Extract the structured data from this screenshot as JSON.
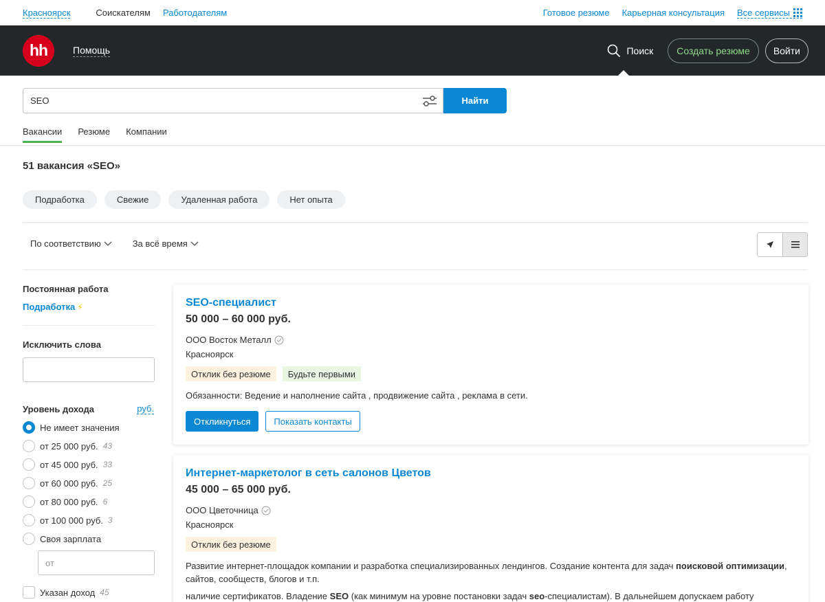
{
  "topbar": {
    "city": "Красноярск",
    "seekers": "Соискателям",
    "employers": "Работодателям",
    "ready_resume": "Готовое резюме",
    "career": "Карьерная консультация",
    "all_services": "Все сервисы"
  },
  "header": {
    "logo": "hh",
    "help": "Помощь",
    "search": "Поиск",
    "create_resume": "Создать резюме",
    "login": "Войти"
  },
  "search": {
    "query": "SEO",
    "find_label": "Найти",
    "tabs": [
      "Вакансии",
      "Резюме",
      "Компании"
    ]
  },
  "results": {
    "title": "51 вакансия «SEO»",
    "chips": [
      "Подработка",
      "Свежие",
      "Удаленная работа",
      "Нет опыта"
    ],
    "sort_relevance": "По соответствию",
    "sort_time": "За всё время"
  },
  "sidebar": {
    "permanent": "Постоянная работа",
    "part_time": "Подработка",
    "exclude_words": "Исключить слова",
    "income_level": "Уровень дохода",
    "currency": "руб.",
    "options": [
      {
        "label": "Не имеет значения",
        "count": ""
      },
      {
        "label": "от 25 000 руб.",
        "count": "43"
      },
      {
        "label": "от 45 000 руб.",
        "count": "33"
      },
      {
        "label": "от 60 000 руб.",
        "count": "25"
      },
      {
        "label": "от 80 000 руб.",
        "count": "6"
      },
      {
        "label": "от 100 000 руб.",
        "count": "3"
      },
      {
        "label": "Своя зарплата",
        "count": ""
      }
    ],
    "own_placeholder": "от",
    "income_specified": "Указан доход",
    "income_specified_count": "45"
  },
  "vacancies": [
    {
      "title": "SEO-специалист",
      "salary": "50 000 – 60 000 руб.",
      "company": "ООО Восток Металл",
      "city": "Красноярск",
      "badge1": "Отклик без резюме",
      "badge2": "Будьте первыми",
      "desc": "Обязанности: Ведение и наполнение сайта , продвижение сайта , реклама в сети.",
      "apply": "Откликнуться",
      "contacts": "Показать контакты"
    },
    {
      "title": "Интернет-маркетолог в сеть салонов Цветов",
      "salary": "45 000 – 65 000 руб.",
      "company": "ООО Цветочница",
      "city": "Красноярск",
      "badge1": "Отклик без резюме",
      "desc_a": "Развитие интернет-площадок компании и разработка специализированных лендингов. Создание контента для задач ",
      "desc_b": "поисковой оптимизации",
      "desc_c": ", сайтов, сообществ, блогов и т.п.",
      "desc2_a": "наличие сертификатов. Владение ",
      "desc2_b": "SEO",
      "desc2_c": " (как минимум на уровне постановки задач ",
      "desc2_d": "seo",
      "desc2_e": "-специалистам). В дальнейшем допускаем работу"
    }
  ]
}
